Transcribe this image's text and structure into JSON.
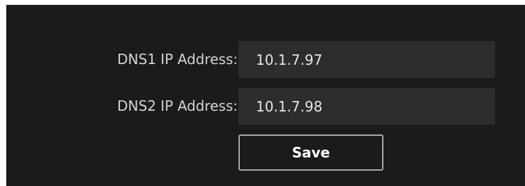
{
  "dns1": {
    "label": "DNS1 IP Address:",
    "value": "10.1.7.97"
  },
  "dns2": {
    "label": "DNS2 IP Address:",
    "value": "10.1.7.98"
  },
  "actions": {
    "save_label": "Save"
  },
  "colors": {
    "panel_background": "#1b1b1b",
    "field_background": "#2d2d2d",
    "label_text": "#d4d4d4",
    "button_border": "#a9a9a9"
  }
}
